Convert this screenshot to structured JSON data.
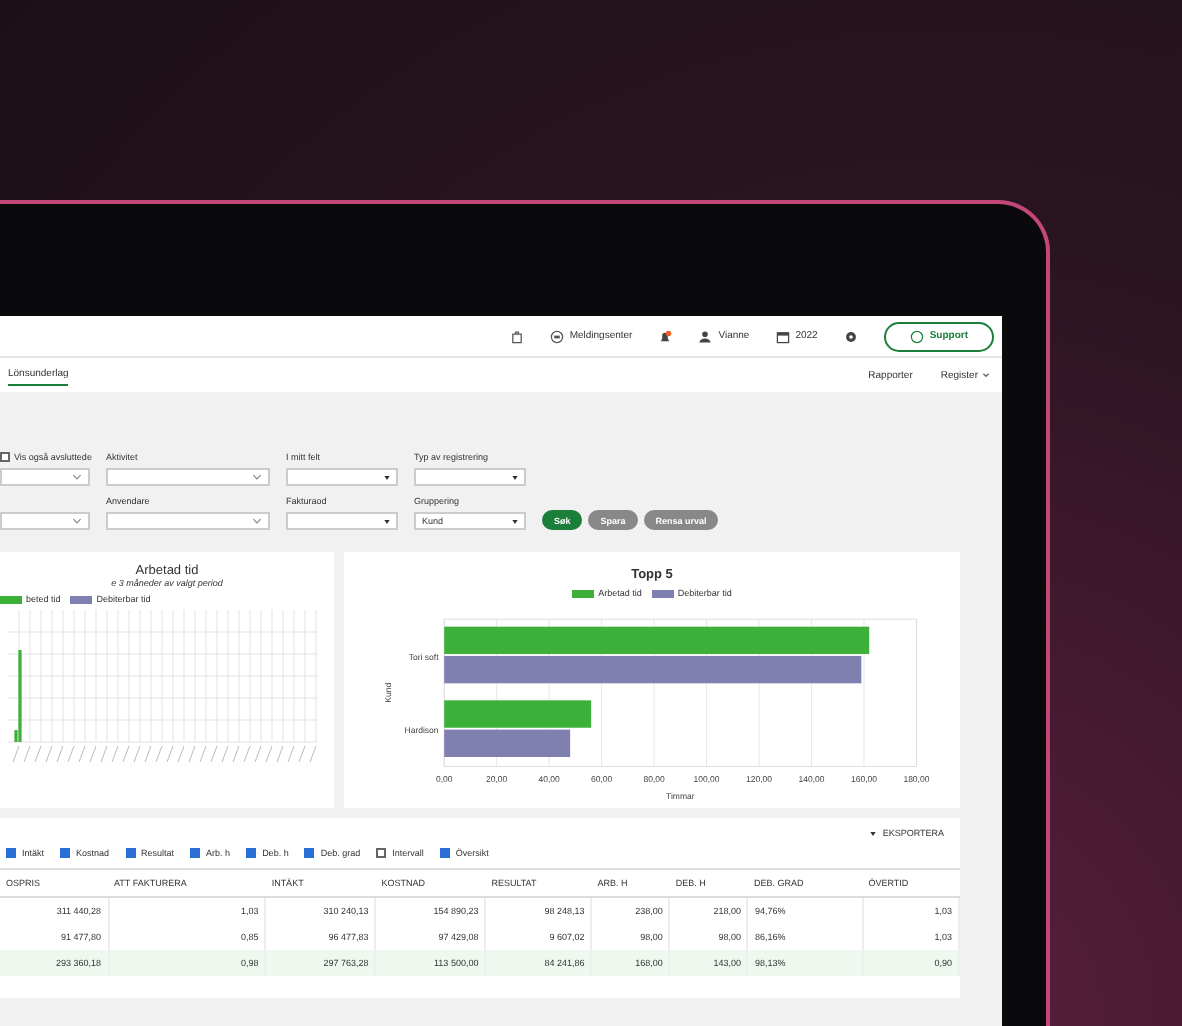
{
  "header": {
    "message_center": "Meldingsenter",
    "user": "Vianne",
    "year": "2022",
    "support_button": "Support"
  },
  "nav": {
    "left": [
      {
        "label": "Lönsunderlag",
        "selected": true
      }
    ],
    "right": [
      {
        "label": "Rapporter",
        "dropdown": false
      },
      {
        "label": "Register",
        "dropdown": true
      }
    ]
  },
  "filters": {
    "show_closed": {
      "label": "Vis også avsluttede",
      "checked": false
    },
    "rows": [
      [
        {
          "kind": "blank-select"
        },
        {
          "kind": "select",
          "label": "Aktivitet"
        },
        {
          "kind": "dropdown",
          "label": "I mitt felt"
        },
        {
          "kind": "dropdown",
          "label": "Typ av registrering"
        }
      ],
      [
        {
          "kind": "blank-select"
        },
        {
          "kind": "select",
          "label": "Anvendare"
        },
        {
          "kind": "dropdown",
          "label": "Fakturaod"
        },
        {
          "kind": "dropdown",
          "label": "Gruppering",
          "value": "Kund"
        }
      ]
    ],
    "buttons": [
      {
        "label": "Søk",
        "kind": "primary"
      },
      {
        "label": "Spara",
        "kind": "secondary"
      },
      {
        "label": "Rensa urval",
        "kind": "secondary"
      }
    ]
  },
  "worked_chart": {
    "title": "Arbetad tid",
    "subtitle": "e 3 måneder av valgt period",
    "legend": [
      {
        "label": "beted tid",
        "color": "#3db03a"
      },
      {
        "label": "Debiterbar tid",
        "color": "#7f7fb0"
      }
    ]
  },
  "top_chart": {
    "chart_data": {
      "type": "bar",
      "orientation": "horizontal",
      "title": "Topp 5",
      "xlabel": "Timmar",
      "ylabel": "Kund",
      "categories": [
        "Tori soft",
        "Hardison"
      ],
      "series": [
        {
          "name": "Arbetad tid",
          "color": "#3db03a",
          "values": [
            162,
            56
          ]
        },
        {
          "name": "Debiterbar tid",
          "color": "#7f7fb0",
          "values": [
            159,
            48
          ]
        }
      ],
      "xlim": [
        0,
        180
      ],
      "grid": true,
      "xticks": [
        {
          "value": 0,
          "label": "0,00"
        },
        {
          "value": 20,
          "label": "20,00"
        },
        {
          "value": 40,
          "label": "40,00"
        },
        {
          "value": 60,
          "label": "60,00"
        },
        {
          "value": 80,
          "label": "80,00"
        },
        {
          "value": 100,
          "label": "100,00"
        },
        {
          "value": 120,
          "label": "120,00"
        },
        {
          "value": 140,
          "label": "140,00"
        },
        {
          "value": 160,
          "label": "160,00"
        },
        {
          "value": 180,
          "label": "180,00"
        }
      ]
    }
  },
  "table": {
    "export": "EKSPORTERA",
    "toggles": [
      {
        "label": "Intäkt",
        "checked": true
      },
      {
        "label": "Kostnad",
        "checked": true
      },
      {
        "label": "Resultat",
        "checked": true
      },
      {
        "label": "Arb. h",
        "checked": true
      },
      {
        "label": "Deb. h",
        "checked": true
      },
      {
        "label": "Deb. grad",
        "checked": true
      },
      {
        "label": "Intervall",
        "checked": false
      },
      {
        "label": "Översikt",
        "checked": true
      }
    ],
    "columns": [
      "OSPRIS",
      "ATT FAKTURERA",
      "INTÄKT",
      "KOSTNAD",
      "RESULTAT",
      "ARB. H",
      "DEB. H",
      "DEB. GRAD",
      "ÖVERTID"
    ],
    "rows": [
      {
        "selected": false,
        "cells": [
          "311 440,28",
          "1,03",
          "310 240,13",
          "154 890,23",
          "98 248,13",
          "238,00",
          "218,00",
          "94,76%",
          "1,03"
        ]
      },
      {
        "selected": false,
        "cells": [
          "91 477,80",
          "0,85",
          "96 477,83",
          "97 429,08",
          "9 607,02",
          "98,00",
          "98,00",
          "86,16%",
          "1,03"
        ]
      },
      {
        "selected": true,
        "cells": [
          "293 360,18",
          "0,98",
          "297 763,28",
          "113 500,00",
          "84 241,86",
          "168,00",
          "143,00",
          "98,13%",
          "0,90"
        ]
      }
    ]
  }
}
